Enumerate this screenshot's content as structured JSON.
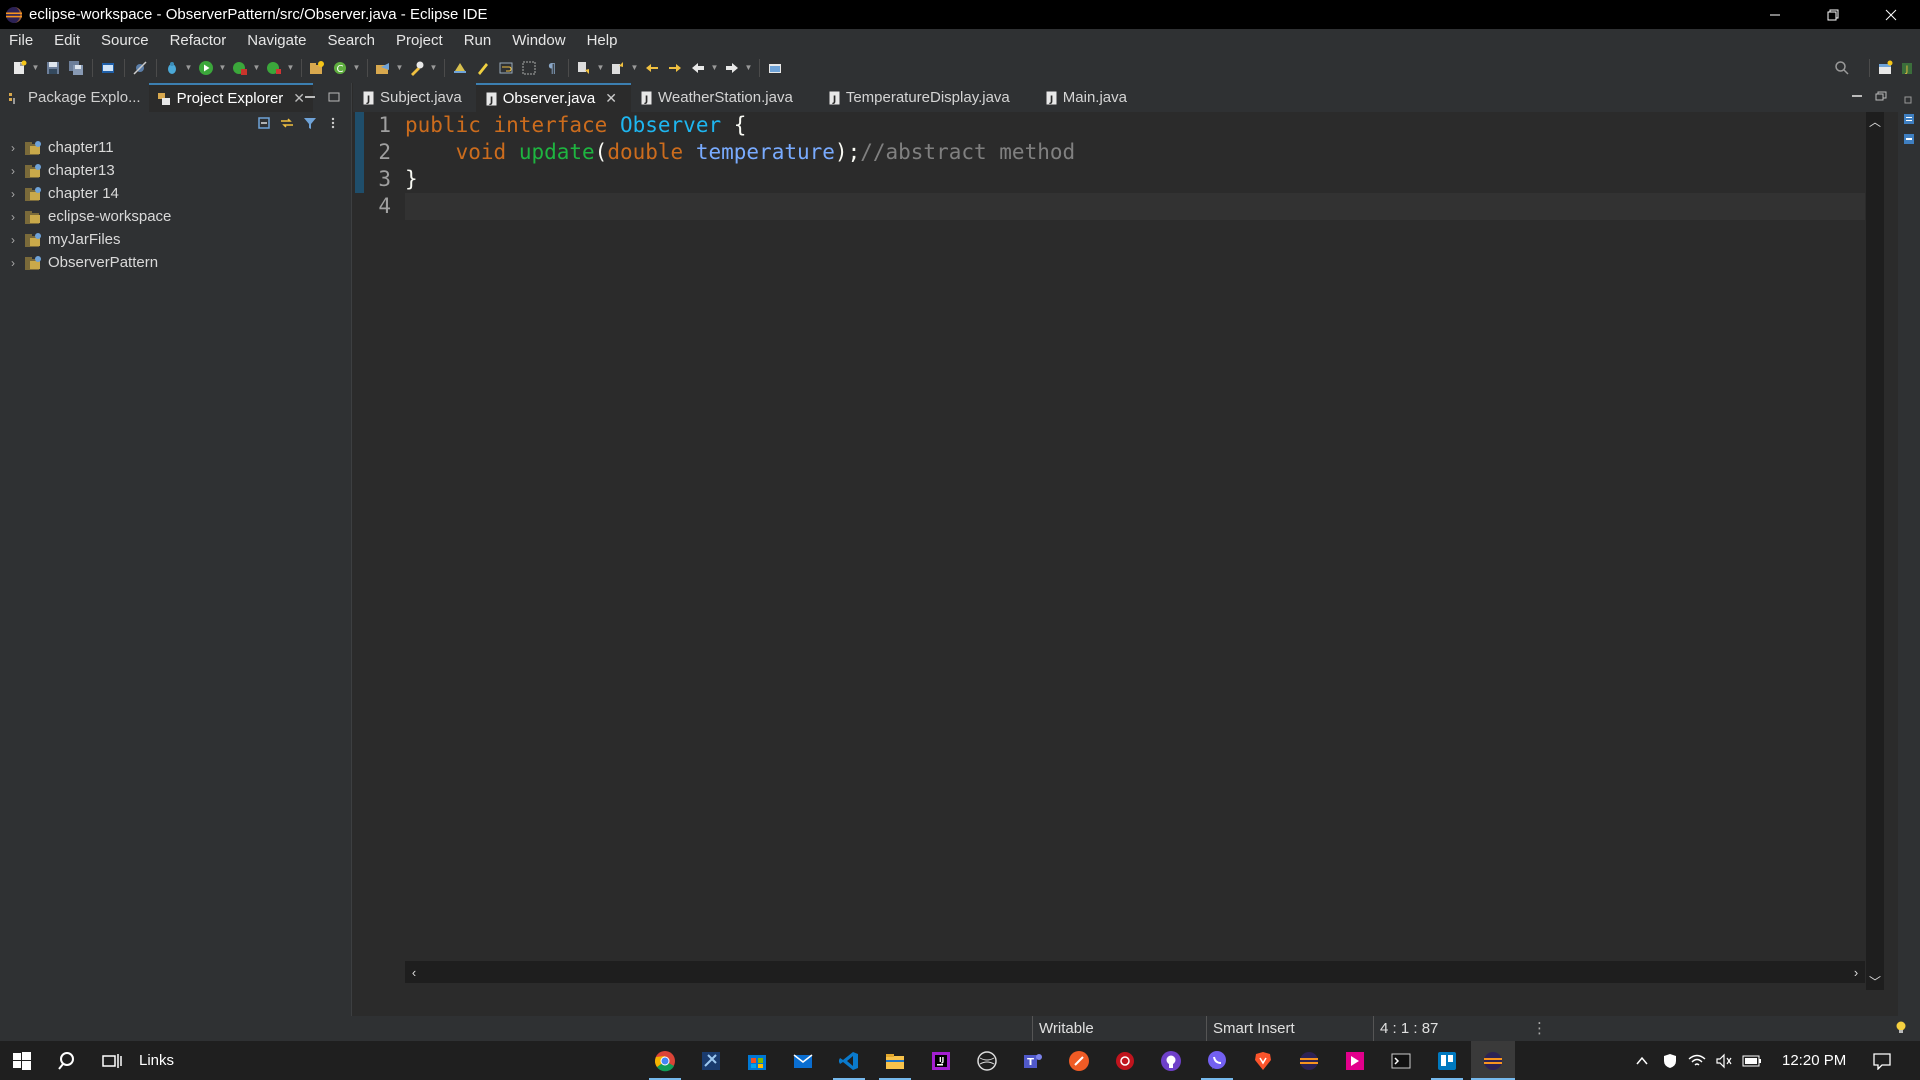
{
  "window": {
    "title": "eclipse-workspace - ObserverPattern/src/Observer.java - Eclipse IDE",
    "controls": [
      "minimize-icon",
      "restore-icon",
      "close-icon"
    ]
  },
  "menu": [
    "File",
    "Edit",
    "Source",
    "Refactor",
    "Navigate",
    "Search",
    "Project",
    "Run",
    "Window",
    "Help"
  ],
  "left_panel": {
    "tabs": [
      {
        "label": "Package Explo...",
        "active": false
      },
      {
        "label": "Project Explorer",
        "active": true
      }
    ],
    "tree": [
      "chapter11",
      "chapter13",
      "chapter 14",
      "eclipse-workspace",
      "myJarFiles",
      "ObserverPattern"
    ]
  },
  "editor": {
    "tabs": [
      {
        "label": "Subject.java",
        "active": false
      },
      {
        "label": "Observer.java",
        "active": true
      },
      {
        "label": "WeatherStation.java",
        "active": false
      },
      {
        "label": "TemperatureDisplay.java",
        "active": false
      },
      {
        "label": "Main.java",
        "active": false
      }
    ],
    "line_numbers": [
      "1",
      "2",
      "3",
      "4"
    ],
    "code": {
      "l1": {
        "kw1": "public",
        "kw2": "interface",
        "type": "Observer",
        "punc": "{"
      },
      "l2": {
        "kw1": "void",
        "meth": "update",
        "open": "(",
        "kw2": "double",
        "param": "temperature",
        "close": ");",
        "cmt": "//abstract method"
      },
      "l3": {
        "punc": "}"
      }
    }
  },
  "status": {
    "writable": "Writable",
    "insert_mode": "Smart Insert",
    "position": "4 : 1 : 87"
  },
  "taskbar": {
    "links": "Links",
    "time": "12:20 PM"
  },
  "colors": {
    "keyword": "#cc6c1d",
    "type": "#1eb6f0",
    "method": "#1eb540",
    "param": "#79abff",
    "comment": "#808080"
  }
}
